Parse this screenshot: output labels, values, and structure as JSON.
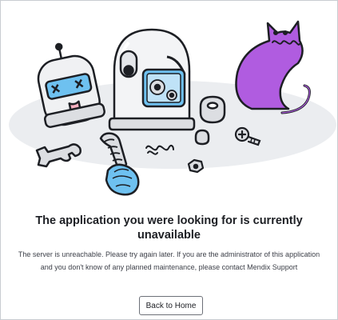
{
  "error": {
    "heading": "The application you were looking for is currently unavailable",
    "message": "The server is unreachable. Please try again later. If you are the administrator of this application and you don't know of any planned maintenance, please contact Mendix Support"
  },
  "actions": {
    "back_home_label": "Back to Home"
  },
  "illustration": {
    "elements": [
      "robot-head-icon",
      "robot-body-icon",
      "cat-icon",
      "wrench-icon",
      "spring-hose-icon",
      "nut-icon",
      "screw-icon",
      "spring-icon"
    ]
  },
  "colors": {
    "ink": "#1d1f24",
    "floor": "#ebedf0",
    "robot_blue": "#6ec1f0",
    "cat_purple": "#b05ce0",
    "metal_gray": "#dcdee2"
  }
}
